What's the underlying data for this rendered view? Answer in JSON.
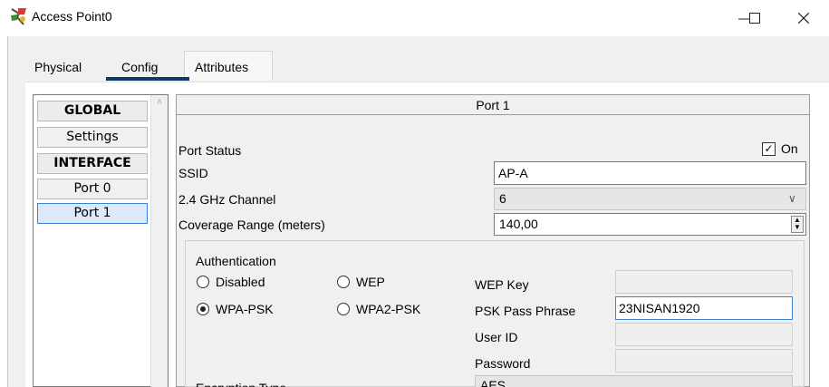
{
  "window": {
    "title": "Access Point0",
    "controls": {
      "minimize": "—",
      "maximize": "☐",
      "close": "✕"
    }
  },
  "tabs": [
    {
      "label": "Physical",
      "active": false
    },
    {
      "label": "Config",
      "active": true
    },
    {
      "label": "Attributes",
      "active": false
    }
  ],
  "sidebar": {
    "items": [
      {
        "label": "GLOBAL",
        "type": "header"
      },
      {
        "label": "Settings",
        "type": "item"
      },
      {
        "label": "INTERFACE",
        "type": "header"
      },
      {
        "label": "Port 0",
        "type": "item"
      },
      {
        "label": "Port 1",
        "type": "item",
        "selected": true
      }
    ]
  },
  "port": {
    "title": "Port 1",
    "status_label": "Port Status",
    "status_on_label": "On",
    "status_checked": true,
    "ssid_label": "SSID",
    "ssid_value": "AP-A",
    "channel_label": "2.4 GHz Channel",
    "channel_value": "6",
    "coverage_label": "Coverage Range (meters)",
    "coverage_value": "140,00"
  },
  "auth": {
    "group_label": "Authentication",
    "options": {
      "disabled": "Disabled",
      "wep": "WEP",
      "wpa_psk": "WPA-PSK",
      "wpa2_psk": "WPA2-PSK"
    },
    "selected": "wpa_psk",
    "wep_key_label": "WEP Key",
    "psk_label": "PSK Pass Phrase",
    "psk_value": "23NISAN1920",
    "user_id_label": "User ID",
    "password_label": "Password"
  },
  "encryption": {
    "label": "Encryption Type",
    "value": "AES"
  },
  "colors": {
    "accent": "#103a66",
    "selection": "#3b82d6"
  }
}
